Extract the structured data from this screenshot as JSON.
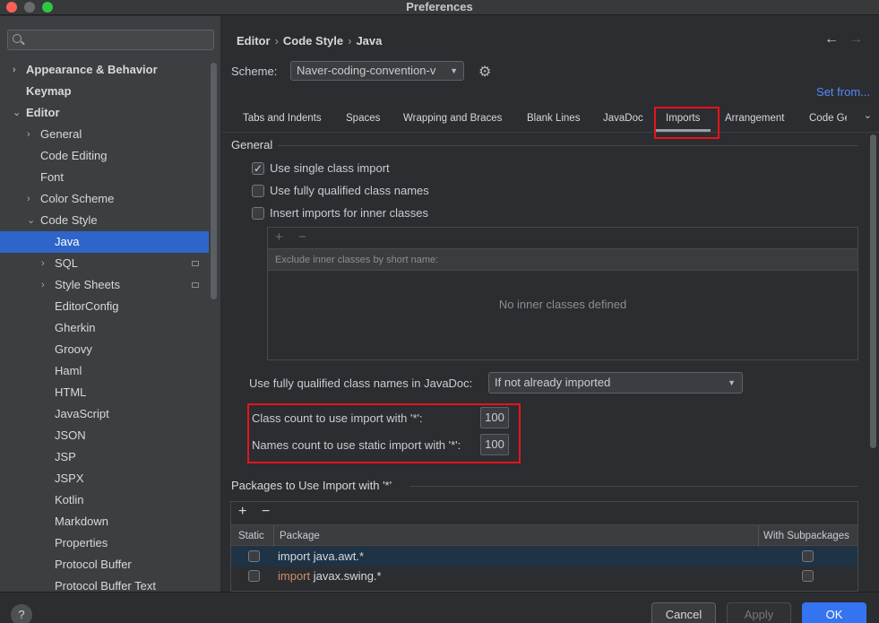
{
  "window": {
    "title": "Preferences"
  },
  "sidebar": {
    "search_placeholder": "",
    "items": [
      {
        "label": "Appearance & Behavior",
        "bold": true,
        "chevron": "›",
        "indent": 0
      },
      {
        "label": "Keymap",
        "bold": true,
        "chevron": "",
        "indent": 0
      },
      {
        "label": "Editor",
        "bold": true,
        "chevron": "⌄",
        "indent": 0
      },
      {
        "label": "General",
        "chevron": "›",
        "indent": 1
      },
      {
        "label": "Code Editing",
        "chevron": "",
        "indent": 1
      },
      {
        "label": "Font",
        "chevron": "",
        "indent": 1
      },
      {
        "label": "Color Scheme",
        "chevron": "›",
        "indent": 1
      },
      {
        "label": "Code Style",
        "chevron": "⌄",
        "indent": 1
      },
      {
        "label": "Java",
        "chevron": "",
        "indent": 2,
        "selected": true
      },
      {
        "label": "SQL",
        "chevron": "›",
        "indent": 2,
        "db_icon": true
      },
      {
        "label": "Style Sheets",
        "chevron": "›",
        "indent": 2,
        "db_icon": true
      },
      {
        "label": "EditorConfig",
        "chevron": "",
        "indent": 2
      },
      {
        "label": "Gherkin",
        "chevron": "",
        "indent": 2
      },
      {
        "label": "Groovy",
        "chevron": "",
        "indent": 2
      },
      {
        "label": "Haml",
        "chevron": "",
        "indent": 2
      },
      {
        "label": "HTML",
        "chevron": "",
        "indent": 2
      },
      {
        "label": "JavaScript",
        "chevron": "",
        "indent": 2
      },
      {
        "label": "JSON",
        "chevron": "",
        "indent": 2
      },
      {
        "label": "JSP",
        "chevron": "",
        "indent": 2
      },
      {
        "label": "JSPX",
        "chevron": "",
        "indent": 2
      },
      {
        "label": "Kotlin",
        "chevron": "",
        "indent": 2
      },
      {
        "label": "Markdown",
        "chevron": "",
        "indent": 2
      },
      {
        "label": "Properties",
        "chevron": "",
        "indent": 2
      },
      {
        "label": "Protocol Buffer",
        "chevron": "",
        "indent": 2
      },
      {
        "label": "Protocol Buffer Text",
        "chevron": "",
        "indent": 2
      }
    ]
  },
  "breadcrumb": {
    "part1": "Editor",
    "part2": "Code Style",
    "part3": "Java",
    "sep": "›"
  },
  "nav": {
    "back": "←",
    "forward": "→"
  },
  "scheme": {
    "label": "Scheme:",
    "value": "Naver-coding-convention-v",
    "set_from": "Set from..."
  },
  "tabs": [
    {
      "label": "Tabs and Indents"
    },
    {
      "label": "Spaces"
    },
    {
      "label": "Wrapping and Braces"
    },
    {
      "label": "Blank Lines"
    },
    {
      "label": "JavaDoc"
    },
    {
      "label": "Imports",
      "active": true
    },
    {
      "label": "Arrangement"
    },
    {
      "label": "Code Ge"
    }
  ],
  "general": {
    "heading": "General",
    "single_class_import": {
      "label": "Use single class import",
      "checked": true
    },
    "fully_qualified": {
      "label": "Use fully qualified class names",
      "checked": false
    },
    "inner_classes": {
      "label": "Insert imports for inner classes",
      "checked": false
    },
    "inner_panel": {
      "add": "+",
      "remove": "−",
      "header": "Exclude inner classes by short name:",
      "empty": "No inner classes defined"
    },
    "javadoc_label": "Use fully qualified class names in JavaDoc:",
    "javadoc_value": "If not already imported",
    "class_count_label": "Class count to use import with '*':",
    "class_count_value": "100",
    "names_count_label": "Names count to use static import with '*':",
    "names_count_value": "100"
  },
  "packages": {
    "heading": "Packages to Use Import with '*'",
    "add": "+",
    "remove": "−",
    "columns": {
      "static": "Static",
      "package": "Package",
      "with_sub": "With Subpackages"
    },
    "rows": [
      {
        "kw": "",
        "name": "import java.awt.*",
        "static": false,
        "with_sub": false,
        "selected": true
      },
      {
        "kw": "import",
        "name": " javax.swing.*",
        "static": false,
        "with_sub": false,
        "selected": false
      }
    ]
  },
  "footer": {
    "help": "?",
    "cancel": "Cancel",
    "apply": "Apply",
    "ok": "OK"
  },
  "colors": {
    "accent": "#3574f0",
    "selection": "#2f65ca",
    "highlight_box": "#e5141b",
    "link": "#548af7"
  }
}
